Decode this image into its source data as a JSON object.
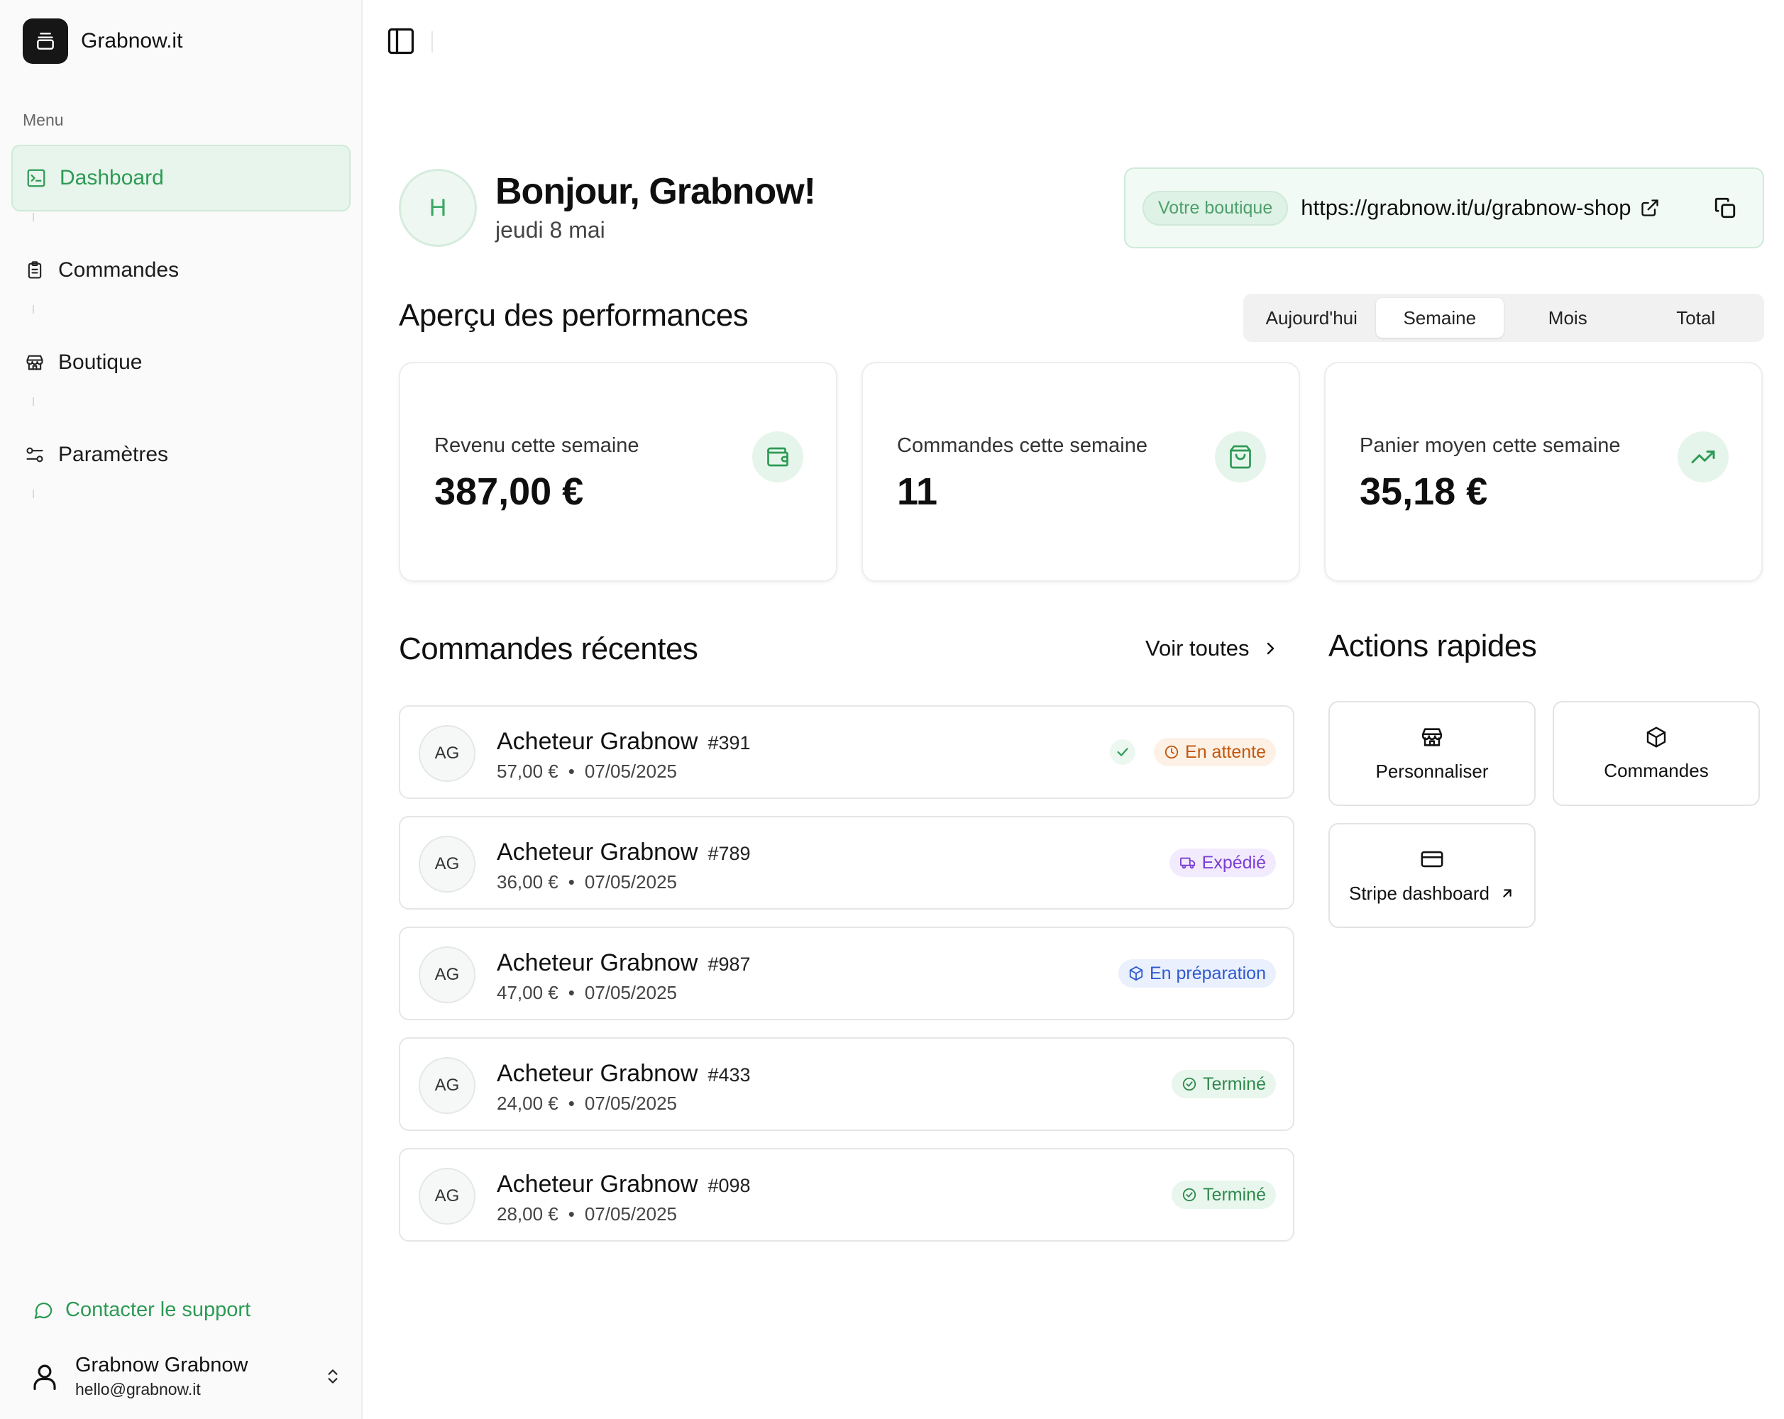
{
  "brand": {
    "name": "Grabnow.it"
  },
  "sidebar": {
    "menu_label": "Menu",
    "items": [
      {
        "label": "Dashboard",
        "icon": "dashboard-icon",
        "active": true
      },
      {
        "label": "Commandes",
        "icon": "clipboard-icon",
        "active": false
      },
      {
        "label": "Boutique",
        "icon": "store-icon",
        "active": false
      },
      {
        "label": "Paramètres",
        "icon": "sliders-icon",
        "active": false
      }
    ],
    "support_label": "Contacter le support",
    "user": {
      "name": "Grabnow Grabnow",
      "email": "hello@grabnow.it"
    }
  },
  "header": {
    "avatar_initial": "H",
    "greeting": "Bonjour, Grabnow!",
    "date": "jeudi 8 mai",
    "shop_badge": "Votre boutique",
    "shop_url": "https://grabnow.it/u/grabnow-shop"
  },
  "performance": {
    "title": "Aperçu des performances",
    "tabs": [
      "Aujourd'hui",
      "Semaine",
      "Mois",
      "Total"
    ],
    "active_tab": "Semaine",
    "stats": [
      {
        "label": "Revenu cette semaine",
        "value": "387,00 €",
        "icon": "wallet-icon"
      },
      {
        "label": "Commandes cette semaine",
        "value": "11",
        "icon": "shopping-bag-icon"
      },
      {
        "label": "Panier moyen cette semaine",
        "value": "35,18 €",
        "icon": "trending-up-icon"
      }
    ]
  },
  "orders": {
    "title": "Commandes récentes",
    "see_all": "Voir toutes",
    "items": [
      {
        "initials": "AG",
        "name": "Acheteur Grabnow",
        "id": "#391",
        "amount": "57,00 €",
        "dot": "•",
        "date": "07/05/2025",
        "status": "En attente"
      },
      {
        "initials": "AG",
        "name": "Acheteur Grabnow",
        "id": "#789",
        "amount": "36,00 €",
        "dot": "•",
        "date": "07/05/2025",
        "status": "Expédié"
      },
      {
        "initials": "AG",
        "name": "Acheteur Grabnow",
        "id": "#987",
        "amount": "47,00 €",
        "dot": "•",
        "date": "07/05/2025",
        "status": "En préparation"
      },
      {
        "initials": "AG",
        "name": "Acheteur Grabnow",
        "id": "#433",
        "amount": "24,00 €",
        "dot": "•",
        "date": "07/05/2025",
        "status": "Terminé"
      },
      {
        "initials": "AG",
        "name": "Acheteur Grabnow",
        "id": "#098",
        "amount": "28,00 €",
        "dot": "•",
        "date": "07/05/2025",
        "status": "Terminé"
      }
    ]
  },
  "quick_actions": {
    "title": "Actions rapides",
    "items": [
      {
        "label": "Personnaliser",
        "icon": "store-icon"
      },
      {
        "label": "Commandes",
        "icon": "package-icon"
      },
      {
        "label": "Stripe dashboard",
        "icon": "credit-card-icon"
      }
    ]
  },
  "colors": {
    "accent": "#2e9a55",
    "accent_bg": "#e7f5ec",
    "status_wait": "#c2570b",
    "status_ship": "#7b3fd4",
    "status_prep": "#2f5bd0",
    "status_done": "#2f8a4d"
  }
}
